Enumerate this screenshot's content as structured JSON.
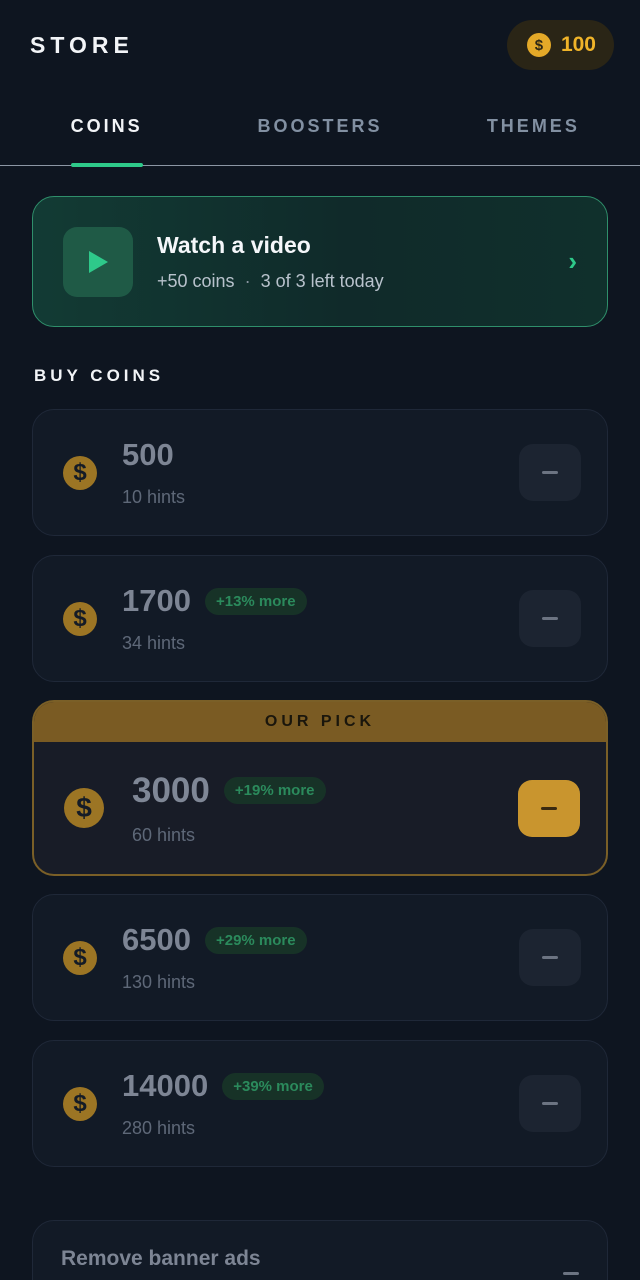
{
  "header": {
    "title": "STORE",
    "balance": "100",
    "coin_icon": "$"
  },
  "tabs": [
    {
      "label": "COINS",
      "active": true
    },
    {
      "label": "BOOSTERS",
      "active": false
    },
    {
      "label": "THEMES",
      "active": false
    }
  ],
  "video": {
    "title": "Watch a video",
    "reward": "+50 coins",
    "separator": "·",
    "remaining": "3 of 3 left today",
    "chevron": "›"
  },
  "buy_section": {
    "title": "BUY COINS"
  },
  "packs": [
    {
      "amount": "500",
      "hints": "10 hints",
      "badge": "",
      "featured": false
    },
    {
      "amount": "1700",
      "hints": "34 hints",
      "badge": "+13% more",
      "featured": false
    },
    {
      "amount": "3000",
      "hints": "60 hints",
      "badge": "+19% more",
      "featured": true,
      "banner": "OUR PICK"
    },
    {
      "amount": "6500",
      "hints": "130 hints",
      "badge": "+29% more",
      "featured": false
    },
    {
      "amount": "14000",
      "hints": "280 hints",
      "badge": "+39% more",
      "featured": false
    }
  ],
  "remove_ads": {
    "title": "Remove banner ads"
  },
  "colors": {
    "background": "#0e1520",
    "accent_green": "#2ec98a",
    "coin_gold": "#f0b429",
    "featured_gold": "#7a5b23"
  }
}
